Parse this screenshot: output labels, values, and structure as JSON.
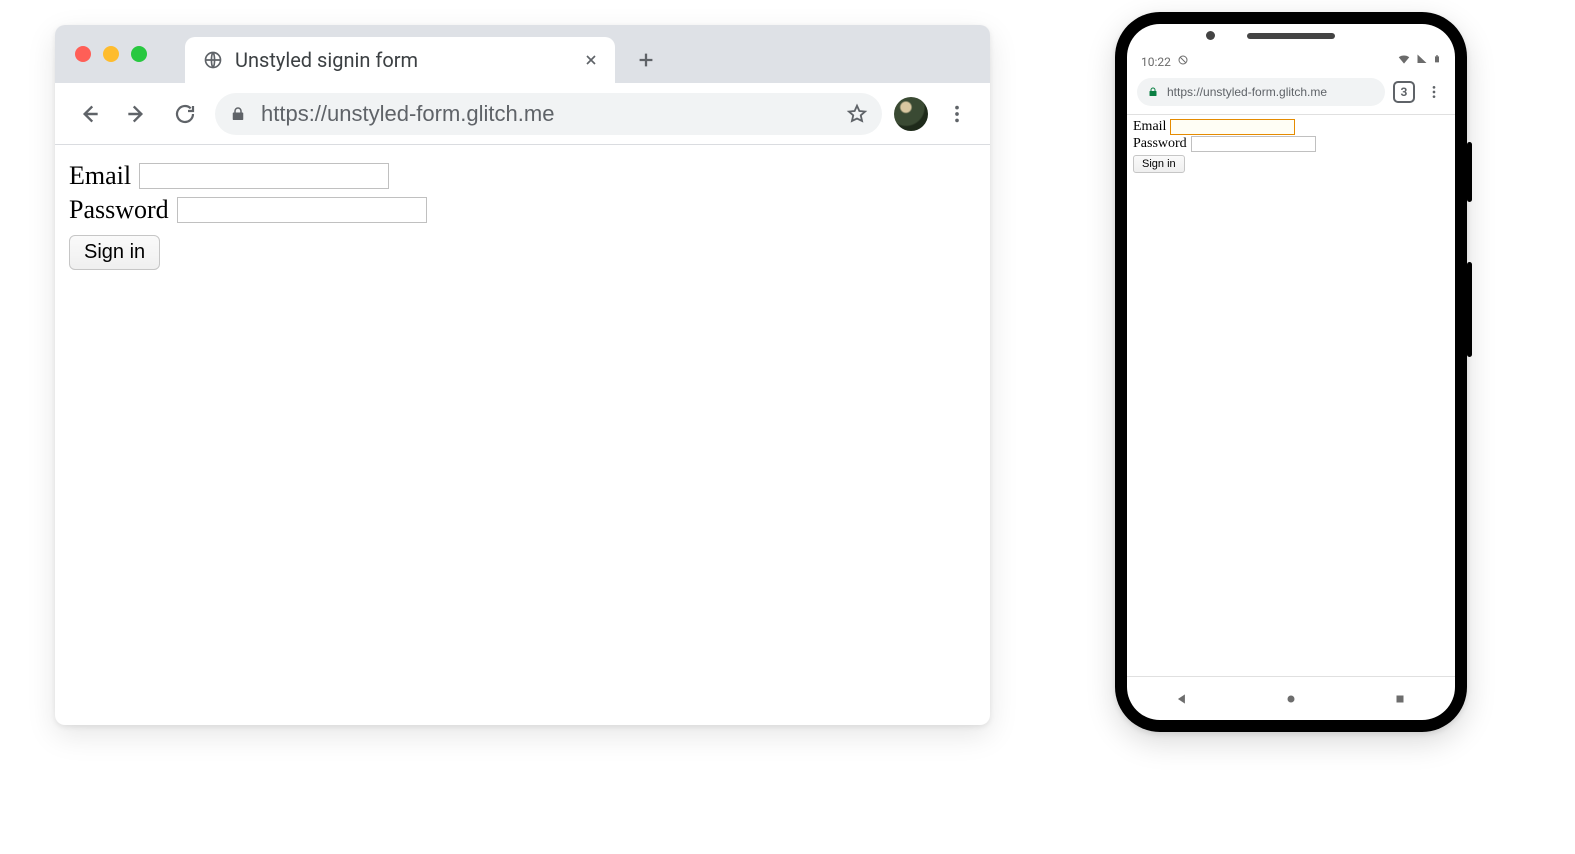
{
  "desktop": {
    "tab_title": "Unstyled signin form",
    "url": "https://unstyled-form.glitch.me",
    "form": {
      "email_label": "Email",
      "password_label": "Password",
      "button_label": "Sign in"
    }
  },
  "mobile": {
    "status": {
      "time": "10:22",
      "tabs_count": "3"
    },
    "url": "https://unstyled-form.glitch.me",
    "form": {
      "email_label": "Email",
      "password_label": "Password",
      "button_label": "Sign in"
    }
  }
}
